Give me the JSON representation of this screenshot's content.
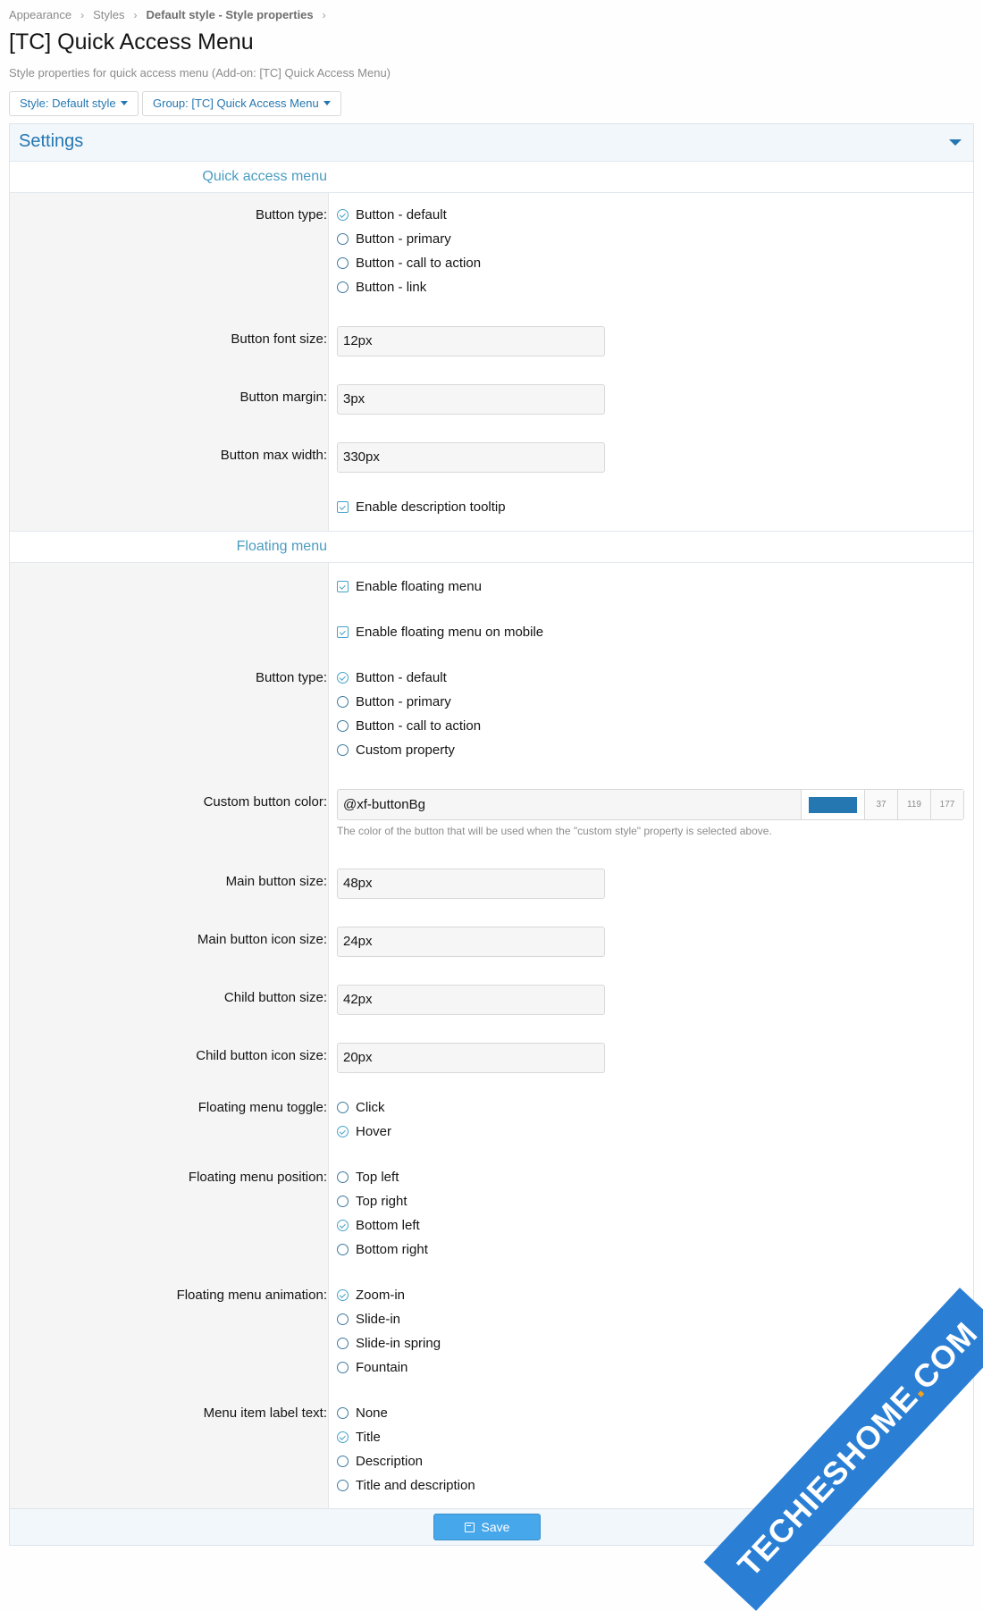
{
  "breadcrumb": [
    "Appearance",
    "Styles",
    "Default style - Style properties"
  ],
  "page": {
    "title": "[TC] Quick Access Menu",
    "description": "Style properties for quick access menu (Add-on: [TC] Quick Access Menu)"
  },
  "filters": {
    "style": "Style: Default style",
    "group": "Group: [TC] Quick Access Menu"
  },
  "panel": {
    "title": "Settings",
    "sections": {
      "quick": "Quick access menu",
      "floating": "Floating menu"
    }
  },
  "quick": {
    "button_type_label": "Button type:",
    "button_type_options": [
      "Button - default",
      "Button - primary",
      "Button - call to action",
      "Button - link"
    ],
    "button_type_selected": "Button - default",
    "font_size_label": "Button font size:",
    "font_size_value": "12px",
    "margin_label": "Button margin:",
    "margin_value": "3px",
    "max_width_label": "Button max width:",
    "max_width_value": "330px",
    "tooltip_label": "Enable description tooltip",
    "tooltip_checked": true
  },
  "floating": {
    "enable_label": "Enable floating menu",
    "enable_mobile_label": "Enable floating menu on mobile",
    "button_type_label": "Button type:",
    "button_type_options": [
      "Button - default",
      "Button - primary",
      "Button - call to action",
      "Custom property"
    ],
    "button_type_selected": "Button - default",
    "custom_color_label": "Custom button color:",
    "custom_color_value": "@xf-buttonBg",
    "custom_color_swatch": "#2577b1",
    "custom_color_rgb": [
      "37",
      "119",
      "177"
    ],
    "custom_color_hint": "The color of the button that will be used when the \"custom style\" property is selected above.",
    "main_size_label": "Main button size:",
    "main_size_value": "48px",
    "main_icon_label": "Main button icon size:",
    "main_icon_value": "24px",
    "child_size_label": "Child button size:",
    "child_size_value": "42px",
    "child_icon_label": "Child button icon size:",
    "child_icon_value": "20px",
    "toggle_label": "Floating menu toggle:",
    "toggle_options": [
      "Click",
      "Hover"
    ],
    "toggle_selected": "Hover",
    "position_label": "Floating menu position:",
    "position_options": [
      "Top left",
      "Top right",
      "Bottom left",
      "Bottom right"
    ],
    "position_selected": "Bottom left",
    "animation_label": "Floating menu animation:",
    "animation_options": [
      "Zoom-in",
      "Slide-in",
      "Slide-in spring",
      "Fountain"
    ],
    "animation_selected": "Zoom-in",
    "label_text_label": "Menu item label text:",
    "label_text_options": [
      "None",
      "Title",
      "Description",
      "Title and description"
    ],
    "label_text_selected": "Title"
  },
  "footer": {
    "save_label": "Save"
  },
  "watermark": {
    "text": "TECHIESHOME",
    "suffix": "COM"
  },
  "colors": {
    "accent": "#2577b1",
    "button": "#47a7eb",
    "section": "#4a9cc2"
  }
}
